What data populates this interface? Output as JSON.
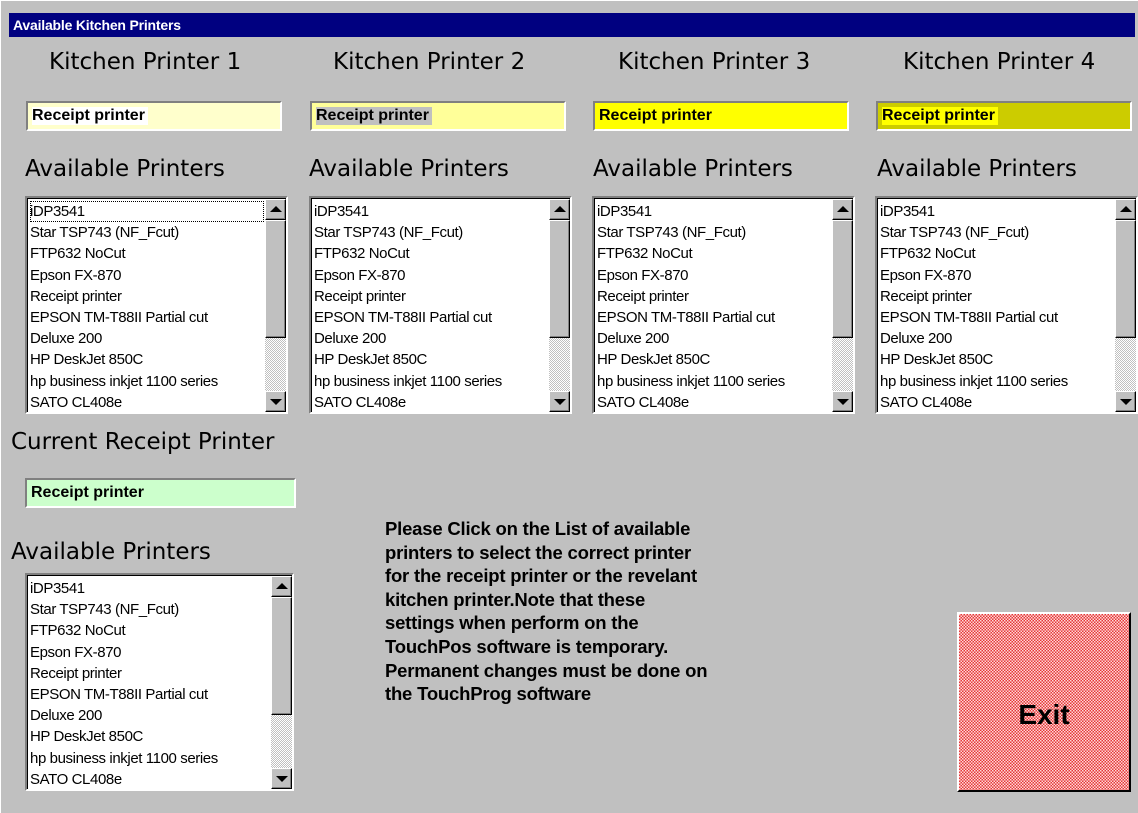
{
  "window": {
    "title": "Available Kitchen Printers"
  },
  "printer_list": [
    "iDP3541",
    "Star TSP743 (NF_Fcut)",
    "FTP632 NoCut",
    "Epson FX-870",
    "Receipt printer",
    "EPSON TM-T88II Partial cut",
    "Deluxe 200",
    "HP DeskJet 850C",
    "hp business inkjet 1100 series",
    "SATO CL408e"
  ],
  "kitchen_printers": [
    {
      "heading": "Kitchen Printer 1",
      "selected": "Receipt printer",
      "field_color": "#ffffcc",
      "available_label": "Available Printers"
    },
    {
      "heading": "Kitchen Printer 2",
      "selected": "Receipt printer",
      "field_color": "#ffff99",
      "available_label": "Available Printers"
    },
    {
      "heading": "Kitchen Printer 3",
      "selected": "Receipt printer",
      "field_color": "#ffff00",
      "available_label": "Available Printers"
    },
    {
      "heading": "Kitchen Printer 4",
      "selected": "Receipt printer",
      "field_color": "#cccc00",
      "available_label": "Available Printers"
    }
  ],
  "receipt": {
    "heading": "Current Receipt Printer",
    "selected": "Receipt printer",
    "field_color": "#ccffcc",
    "available_label": "Available Printers"
  },
  "instructions": [
    "Please Click on the List of available",
    "printers to select the correct printer",
    "for the receipt printer or the revelant",
    "kitchen printer.Note that these",
    "settings when perform on the",
    "TouchPos software is temporary.",
    "Permanent changes must be done on",
    "the TouchProg software"
  ],
  "exit_label": "Exit",
  "colors": {
    "titlebar": "#000080",
    "background": "#c0c0c0",
    "exit_button": "#e43838"
  }
}
